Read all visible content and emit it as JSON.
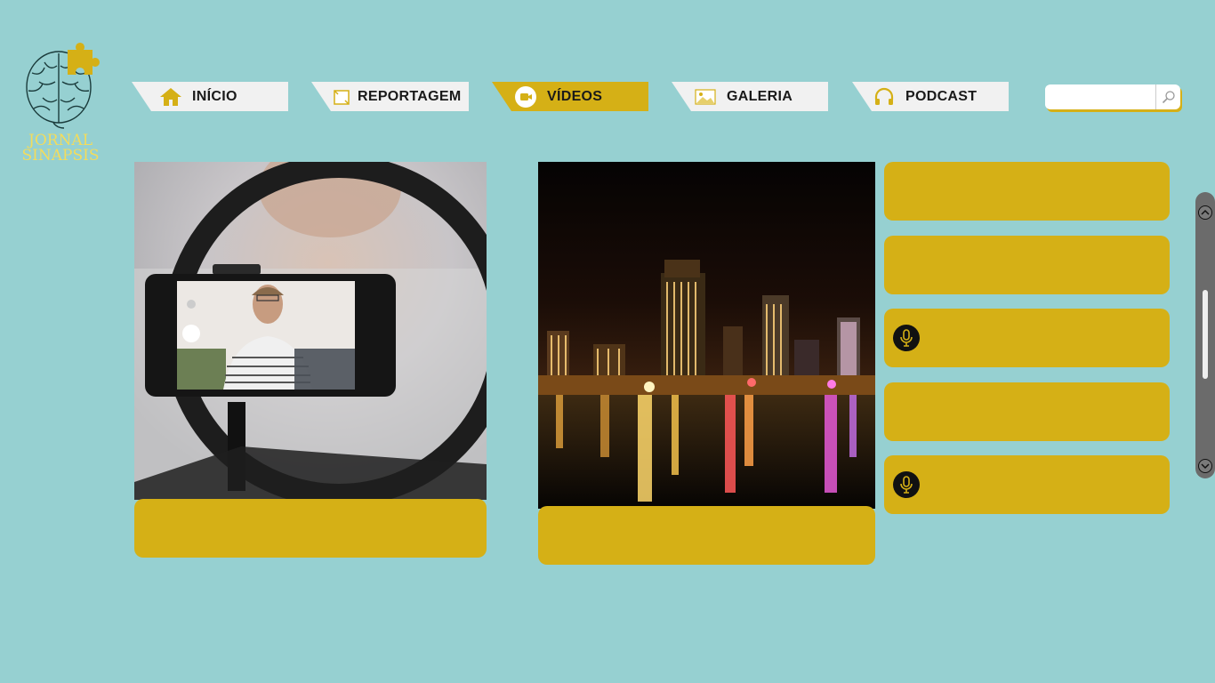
{
  "brand": {
    "line1": "JORNAL",
    "line2": "SINAPSIS"
  },
  "nav": {
    "tabs": [
      {
        "label": "INÍCIO",
        "icon": "home-icon",
        "active": false
      },
      {
        "label": "REPORTAGEM",
        "icon": "report-icon",
        "active": false
      },
      {
        "label": "VÍDEOS",
        "icon": "video-camera-icon",
        "active": true
      },
      {
        "label": "GALERIA",
        "icon": "image-icon",
        "active": false
      },
      {
        "label": "PODCAST",
        "icon": "headphones-icon",
        "active": false
      }
    ]
  },
  "search": {
    "value": "",
    "placeholder": ""
  },
  "cards": [
    {
      "image": "ring-light-phone-photo",
      "caption": ""
    },
    {
      "image": "night-city-skyline-photo",
      "caption": ""
    }
  ],
  "list": {
    "items": [
      {
        "label": "",
        "icon": ""
      },
      {
        "label": "",
        "icon": ""
      },
      {
        "label": "",
        "icon": "microphone-icon"
      },
      {
        "label": "",
        "icon": ""
      },
      {
        "label": "",
        "icon": "microphone-icon"
      }
    ]
  },
  "colors": {
    "background": "#96d0d1",
    "accent": "#d5b016",
    "tab_inactive": "#f1f1f1",
    "logo": "#f3dc5c"
  }
}
